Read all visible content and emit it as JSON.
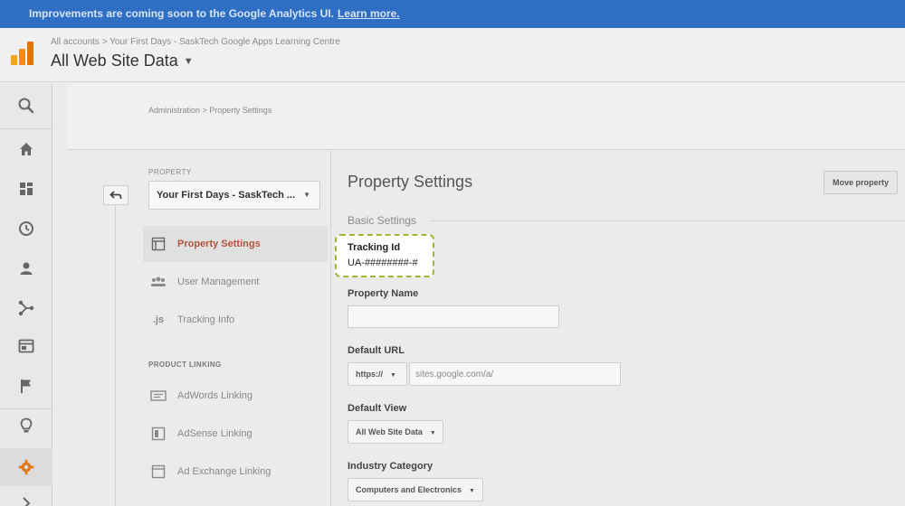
{
  "banner": {
    "message": "Improvements are coming soon to the Google Analytics UI.",
    "link": "Learn more."
  },
  "header": {
    "breadcrumb": "All accounts > Your First Days - SaskTech Google Apps Learning Centre",
    "view_name": "All Web Site Data",
    "view_caret": "▼"
  },
  "leftnav": {
    "icons": [
      "search-icon",
      "home-icon",
      "dashboard-icon",
      "clock-icon",
      "person-icon",
      "acquisition-icon",
      "behavior-icon",
      "flag-icon",
      "lightbulb-icon",
      "gear-icon",
      "expand-icon"
    ],
    "accent_color": "#e07a21"
  },
  "admin": {
    "breadcrumb": "Administration > Property Settings"
  },
  "property_panel": {
    "label": "PROPERTY",
    "selected_property": "Your First Days - SaskTech ...",
    "menu": [
      {
        "label": "Property Settings",
        "icon": "property-icon"
      },
      {
        "label": "User Management",
        "icon": "users-icon"
      },
      {
        "label": "Tracking Info",
        "icon": "js-icon"
      }
    ],
    "product_linking_heading": "PRODUCT LINKING",
    "product_linking": [
      {
        "label": "AdWords Linking",
        "icon": "adwords-icon"
      },
      {
        "label": "AdSense Linking",
        "icon": "adsense-icon"
      },
      {
        "label": "Ad Exchange Linking",
        "icon": "adexchange-icon"
      }
    ]
  },
  "main": {
    "title": "Property Settings",
    "move_button": "Move property",
    "basic_settings_heading": "Basic Settings",
    "tracking_id": {
      "label": "Tracking Id",
      "value": "UA-########-#"
    },
    "property_name": {
      "label": "Property Name",
      "value": ""
    },
    "default_url": {
      "label": "Default URL",
      "protocol": "https://",
      "url": "sites.google.com/a/"
    },
    "default_view": {
      "label": "Default View",
      "value": "All Web Site Data"
    },
    "industry_category": {
      "label": "Industry Category",
      "value": "Computers and Electronics"
    },
    "callout_color": "#9bb832"
  }
}
